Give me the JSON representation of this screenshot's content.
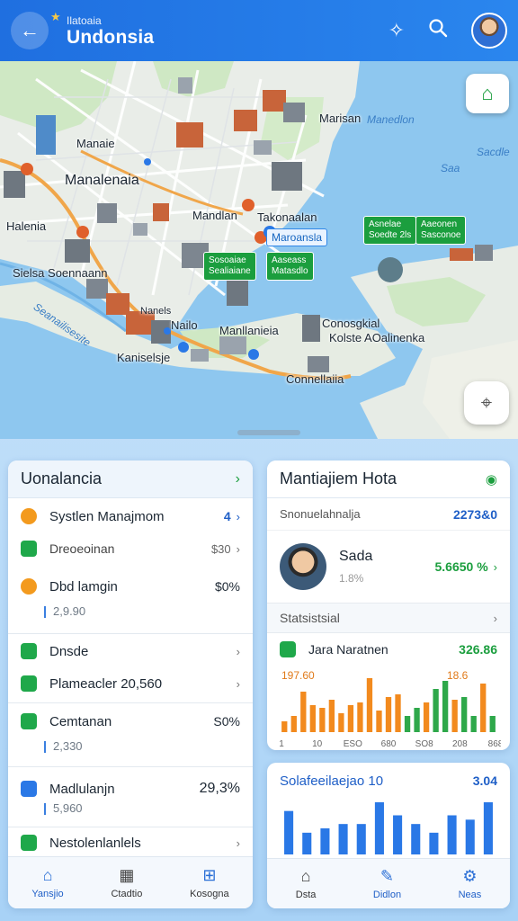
{
  "header": {
    "subtitle": "Ilatoaia",
    "title": "Undonsia",
    "back_icon": "back-arrow-icon",
    "sparkle_icon": "sparkle-icon",
    "search_icon": "search-icon"
  },
  "map": {
    "labels": {
      "manaie": "Manaie",
      "manalenaia": "Manalenaia",
      "halenia": "Halenia",
      "manlan": "Mandlan",
      "takonsalan": "Takonaalan",
      "sielsa": "Sielsa Soennaann",
      "nansls": "Nanels",
      "nailo": "Nailo",
      "manllanieia": "Manllanieia",
      "kaniselsie": "Kaniselsje",
      "conoerai": "Conosgkial",
      "kolastle": "Kolste AOalinenka",
      "connelaia": "Connellaiia",
      "marisa": "Marisan"
    },
    "sea_labels": {
      "a": "Manedlon",
      "b": "Sacdle",
      "c": "Seanailisesite",
      "d": "Saa"
    },
    "tags": {
      "maroansia": "Maroansla",
      "tag1": "Sosoaiae\nSealiaiane",
      "tag2": "Aaseass\nMatasdlo",
      "tag3": "Asnelae\nSoedte 2ls",
      "tag4": "Aaeonen\nSasconoe"
    },
    "fab_top_icon": "store-icon",
    "fab_locate_icon": "locate-icon"
  },
  "left_card": {
    "title": "Uonalancia",
    "rows": [
      {
        "label": "Systlen Manajmom",
        "value": "4",
        "icon": "orange"
      },
      {
        "label": "Dreoeoinan",
        "value": "$30",
        "icon": "green"
      },
      {
        "label": "Dbd lamgin",
        "value": "$0%",
        "icon": "orange",
        "sub": "2,9.90"
      },
      {
        "label": "Dnsde",
        "value": "",
        "icon": "green"
      },
      {
        "label": "Plameacler 20,560",
        "value": "",
        "icon": "green"
      },
      {
        "label": "Cemtanan",
        "value": "S0%",
        "icon": "green",
        "sub": "2,330"
      },
      {
        "label": "Madlulanjn",
        "value": "29,3%",
        "icon": "blue",
        "sub": "5,960"
      },
      {
        "label": "Nestolenlanlels",
        "value": "",
        "icon": "green"
      }
    ],
    "nav": [
      {
        "label": "Yansjio",
        "icon": "home-icon"
      },
      {
        "label": "Ctadtio",
        "icon": "calendar-icon"
      },
      {
        "label": "Kosogna",
        "icon": "grid-icon"
      }
    ]
  },
  "right_card": {
    "title": "Mantiajiem Hota",
    "row1_label": "Snonuelahnalja",
    "row1_value": "2273&0",
    "person_name": "Sada",
    "person_pct": "1.8%",
    "person_value": "5.6650 %",
    "stats_label": "Statsistsial",
    "stat_row_label": "Jara Naratnen",
    "stat_row_value": "326.86",
    "chart_left_label": "197.60",
    "chart_right_label": "18.6",
    "x_ticks": [
      "1",
      "10",
      "ESO",
      "680",
      "SO8",
      "208",
      "868"
    ]
  },
  "chart_data": [
    {
      "type": "bar",
      "title": "",
      "series": [
        {
          "values": [
            4,
            6,
            15,
            10,
            9,
            12,
            7,
            10,
            11,
            20,
            8,
            13,
            14,
            6,
            9,
            11,
            16,
            19,
            12,
            13,
            6,
            18,
            6
          ]
        }
      ],
      "colors": [
        "#f28a1e",
        "#2ea84a"
      ],
      "annotations": [
        "197.60",
        "18.6"
      ]
    },
    {
      "type": "bar",
      "title": "Solafeeilaejao 10",
      "value_label": "3.04",
      "series": [
        {
          "values": [
            10,
            5,
            6,
            7,
            7,
            12,
            9,
            7,
            5,
            9,
            8,
            12
          ]
        }
      ],
      "colors": [
        "#2a78e6"
      ]
    }
  ],
  "right_card2": {
    "title": "Solafeeilaejao 10",
    "value": "3.04"
  },
  "right_nav": [
    {
      "label": "Dsta",
      "icon": "house-icon"
    },
    {
      "label": "Didlon",
      "icon": "edit-icon"
    },
    {
      "label": "Neas",
      "icon": "gear-icon"
    }
  ]
}
